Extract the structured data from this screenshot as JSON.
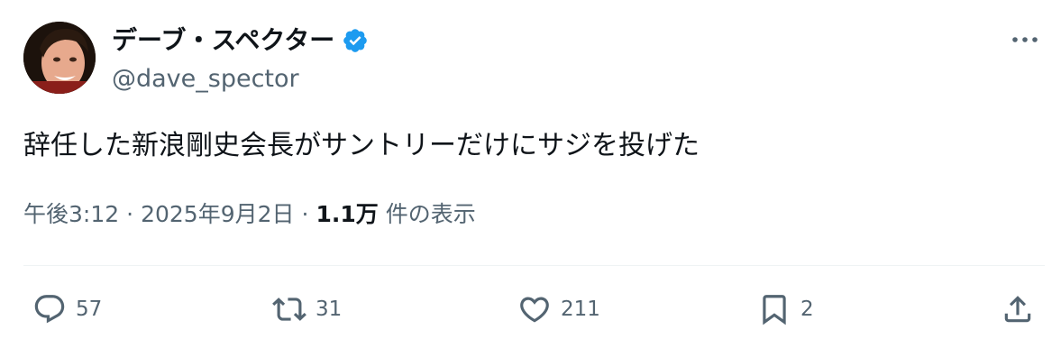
{
  "author": {
    "display_name": "デーブ・スペクター",
    "handle": "@dave_spector"
  },
  "tweet": {
    "text": "辞任した新浪剛史会長がサントリーだけにサジを投げた"
  },
  "meta": {
    "time": "午後3:12",
    "separator": "·",
    "date": "2025年9月2日",
    "views_count": "1.1万",
    "views_label": "件の表示"
  },
  "actions": {
    "reply_count": "57",
    "retweet_count": "31",
    "like_count": "211",
    "bookmark_count": "2"
  },
  "colors": {
    "text": "#0f1419",
    "secondary": "#536471",
    "verified": "#1d9bf0",
    "divider": "#eff3f4"
  },
  "icons": [
    "verified-badge-icon",
    "more-icon",
    "reply-icon",
    "retweet-icon",
    "like-icon",
    "bookmark-icon",
    "share-icon"
  ]
}
